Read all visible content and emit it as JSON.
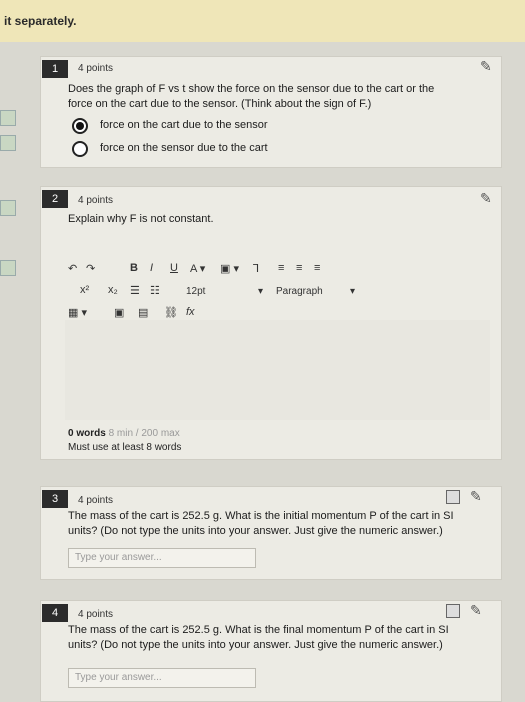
{
  "banner": {
    "text": "it separately."
  },
  "questions": [
    {
      "num": "1",
      "points": "4 points",
      "text_line1": "Does the graph of F",
      "text_line2": "force on the cart due to the sensor. (Think about the sign of F",
      "options": [
        "force on the cart due to the sensor",
        "force on the sensor due to the cart"
      ]
    },
    {
      "num": "2",
      "points": "4 points",
      "text": "Explain why F is not constant."
    },
    {
      "num": "3",
      "points": "4 points",
      "text_line1": "The mass of the cart is 252.5 g. What is the initial momentum P of the cart in SI",
      "text_line2": "units? (Do not type the units into your answer. Just give the numeric answer.)",
      "placeholder": "Type your answer..."
    },
    {
      "num": "4",
      "points": "4 points",
      "text_line1": "The mass of the cart is 252.5 g. What is the final momentum P of the cart in SI",
      "text_line2": "units? (Do not type the units into your answer. Just give the numeric answer.)",
      "placeholder": "Type your answer..."
    }
  ],
  "q1_extra": {
    "vs": "vs t show the force on the sensor due to the cart or the",
    "close": ".)"
  },
  "toolbar": {
    "font_size": "12pt",
    "paragraph": "Paragraph"
  },
  "wordcount": {
    "words": "0 words",
    "limit": "8 min / 200 max",
    "hint": "Must use at least 8 words"
  }
}
